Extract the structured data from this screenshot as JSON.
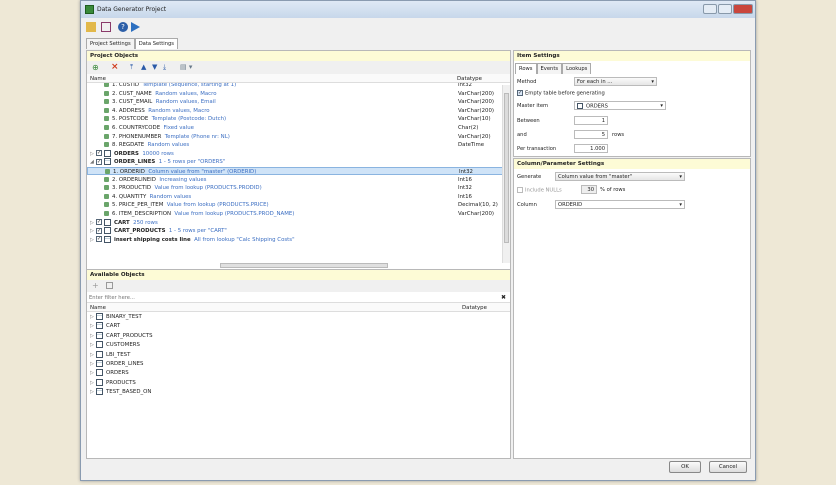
{
  "window": {
    "title": "Data Generator Project"
  },
  "tabs": [
    "Project Settings",
    "Data Settings"
  ],
  "project_objects": {
    "title": "Project Objects",
    "columns": {
      "name": "Name",
      "datatype": "Datatype"
    },
    "rows": [
      {
        "label": "1. CUSTID",
        "desc": "Template (Sequence, starting at 1)",
        "type": "Int32",
        "kind": "col"
      },
      {
        "label": "2. CUST_NAME",
        "desc": "Random values, Macro",
        "type": "VarChar(200)",
        "kind": "col"
      },
      {
        "label": "3. CUST_EMAIL",
        "desc": "Random values, Email",
        "type": "VarChar(200)",
        "kind": "col"
      },
      {
        "label": "4. ADDRESS",
        "desc": "Random values, Macro",
        "type": "VarChar(200)",
        "kind": "col"
      },
      {
        "label": "5. POSTCODE",
        "desc": "Template (Postcode: Dutch)",
        "type": "VarChar(10)",
        "kind": "col"
      },
      {
        "label": "6. COUNTRYCODE",
        "desc": "Fixed value",
        "type": "Char(2)",
        "kind": "col"
      },
      {
        "label": "7. PHONENUMBER",
        "desc": "Template (Phone nr: NL)",
        "type": "VarChar(20)",
        "kind": "col"
      },
      {
        "label": "8. REGDATE",
        "desc": "Random values",
        "type": "DateTime",
        "kind": "col"
      },
      {
        "label": "ORDERS",
        "desc": "10000 rows",
        "type": "",
        "kind": "table"
      },
      {
        "label": "ORDER_LINES",
        "desc": "1 - 5 rows per \"ORDERS\"",
        "type": "",
        "kind": "table-open"
      },
      {
        "label": "1. ORDERID",
        "desc": "Column value from \"master\" (ORDERID)",
        "type": "Int32",
        "kind": "col",
        "selected": true
      },
      {
        "label": "2. ORDERLINEID",
        "desc": "Increasing values",
        "type": "Int16",
        "kind": "col"
      },
      {
        "label": "3. PRODUCTID",
        "desc": "Value from lookup (PRODUCTS.PRODID)",
        "type": "Int32",
        "kind": "col"
      },
      {
        "label": "4. QUANTITY",
        "desc": "Random values",
        "type": "Int16",
        "kind": "col"
      },
      {
        "label": "5. PRICE_PER_ITEM",
        "desc": "Value from lookup (PRODUCTS.PRICE)",
        "type": "Decimal(10, 2)",
        "kind": "col"
      },
      {
        "label": "6. ITEM_DESCRIPTION",
        "desc": "Value from lookup (PRODUCTS.PROD_NAME)",
        "type": "VarChar(200)",
        "kind": "col"
      },
      {
        "label": "CART",
        "desc": "250 rows",
        "type": "",
        "kind": "table"
      },
      {
        "label": "CART_PRODUCTS",
        "desc": "1 - 5 rows per \"CART\"",
        "type": "",
        "kind": "table"
      },
      {
        "label": "insert shipping costs line",
        "desc": "All from lookup \"Calc Shipping Costs\"",
        "type": "",
        "kind": "table"
      }
    ]
  },
  "available_objects": {
    "title": "Available Objects",
    "filter_placeholder": "Enter filter here...",
    "columns": {
      "name": "Name",
      "datatype": "Datatype"
    },
    "items": [
      "BINARY_TEST",
      "CART",
      "CART_PRODUCTS",
      "CUSTOMERS",
      "LBI_TEST",
      "ORDER_LINES",
      "ORDERS",
      "PRODUCTS",
      "TEST_BASED_ON"
    ]
  },
  "item_settings": {
    "title": "Item Settings",
    "tabs": [
      "Rows",
      "Events",
      "Lookups"
    ],
    "method_label": "Method",
    "method_value": "For each in ...",
    "empty_table_label": "Empty table before generating",
    "master_label": "Master item",
    "master_value": "ORDERS",
    "between_label": "Between",
    "between_value": "1",
    "and_label": "and",
    "and_value": "5",
    "rows_suffix": "rows",
    "per_tx_label": "Per transaction",
    "per_tx_value": "1.000"
  },
  "column_settings": {
    "title": "Column/Parameter Settings",
    "generate_label": "Generate",
    "generate_value": "Column value from \"master\"",
    "include_nulls_label": "Include NULLs",
    "nulls_value": "30",
    "nulls_suffix": "% of rows",
    "column_label": "Column",
    "column_value": "ORDERID"
  },
  "buttons": {
    "ok": "OK",
    "cancel": "Cancel"
  }
}
